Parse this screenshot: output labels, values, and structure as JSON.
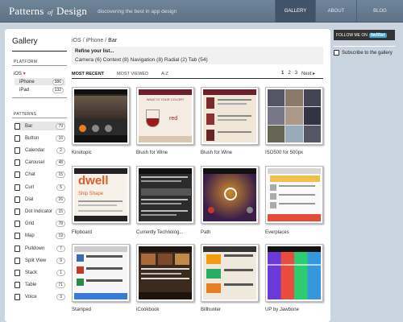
{
  "header": {
    "logo_main": "Patterns",
    "logo_of": "of",
    "logo_end": "Design",
    "tagline": "discovering the best in app design",
    "nav": [
      "GALLERY",
      "ABOUT",
      "BLOG"
    ]
  },
  "sidebar": {
    "title": "Gallery",
    "platform_heading": "PLATFORM",
    "os": "iOS",
    "platforms": [
      {
        "label": "iPhone",
        "count": "386"
      },
      {
        "label": "iPad",
        "count": "132"
      }
    ],
    "patterns_heading": "PATTERNS",
    "patterns": [
      {
        "label": "Bar",
        "count": "79"
      },
      {
        "label": "Button",
        "count": "16"
      },
      {
        "label": "Calendar",
        "count": "2"
      },
      {
        "label": "Carousel",
        "count": "48"
      },
      {
        "label": "Chat",
        "count": "15"
      },
      {
        "label": "Curl",
        "count": "5"
      },
      {
        "label": "Dial",
        "count": "26"
      },
      {
        "label": "Dot Indicator",
        "count": "15"
      },
      {
        "label": "Grid",
        "count": "78"
      },
      {
        "label": "Map",
        "count": "19"
      },
      {
        "label": "Pulldown",
        "count": "7"
      },
      {
        "label": "Split View",
        "count": "9"
      },
      {
        "label": "Stack",
        "count": "1"
      },
      {
        "label": "Table",
        "count": "71"
      },
      {
        "label": "Voice",
        "count": "3"
      }
    ]
  },
  "breadcrumb": {
    "a": "iOS",
    "b": "iPhone",
    "c": "Bar",
    "sep": " / "
  },
  "refine": {
    "title": "Refine your list...",
    "filters": "Camera (6)   Context (8)   Navigation (8)   Radial (2)   Tab (54)"
  },
  "tabs": [
    "MOST RECENT",
    "MOST VIEWED",
    "A-Z"
  ],
  "pager": [
    "1",
    "2",
    "3",
    "Next ▸"
  ],
  "tiles": [
    {
      "caption": "Kinotopic"
    },
    {
      "caption": "Blush for Wine"
    },
    {
      "caption": "Blush for Wine"
    },
    {
      "caption": "ISO500 for 500px"
    },
    {
      "caption": "Flipboard"
    },
    {
      "caption": "Currently Technolog..."
    },
    {
      "caption": "Path"
    },
    {
      "caption": "Everplaces"
    },
    {
      "caption": "Stamped"
    },
    {
      "caption": "iCookbook"
    },
    {
      "caption": "Billhunter"
    },
    {
      "caption": "UP by Jawbone"
    }
  ],
  "tile_text": {
    "blush_q": "WHAT IS YOUR COLOR?",
    "blush_a": "red",
    "dwell": "dwell",
    "ship": "Ship Shape"
  },
  "right": {
    "follow": "FOLLOW ME ON",
    "twitter": "twitter",
    "subscribe": "Subscribe to the gallery"
  }
}
